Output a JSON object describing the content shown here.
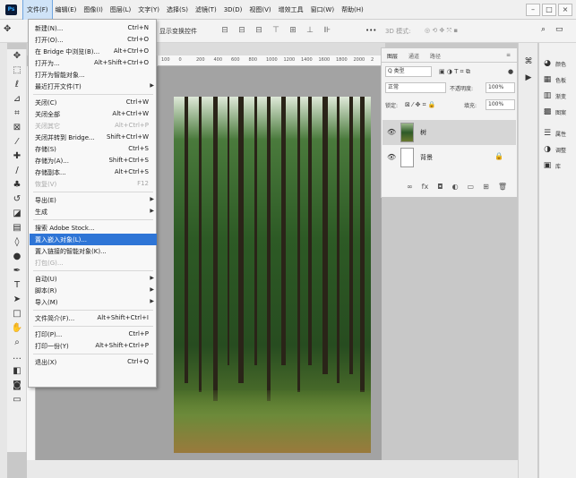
{
  "app": {
    "logo": "Ps"
  },
  "menubar": {
    "items": [
      "文件(F)",
      "编辑(E)",
      "图像(I)",
      "图层(L)",
      "文字(Y)",
      "选择(S)",
      "滤镜(T)",
      "3D(D)",
      "视图(V)",
      "增效工具",
      "窗口(W)",
      "帮助(H)"
    ],
    "window_buttons": [
      "–",
      "□",
      "×"
    ]
  },
  "options_bar": {
    "show_transform": "显示变换控件",
    "mode_3d": "3D 模式:",
    "more": "•••"
  },
  "ruler": {
    "top_ticks": [
      "100",
      "0",
      "200",
      "400",
      "600",
      "800",
      "1000",
      "1200",
      "1400",
      "1600",
      "1800",
      "2000",
      "2"
    ]
  },
  "file_menu": [
    {
      "label": "新建(N)...",
      "shortcut": "Ctrl+N",
      "disabled": false
    },
    {
      "label": "打开(O)...",
      "shortcut": "Ctrl+O",
      "disabled": false
    },
    {
      "label": "在 Bridge 中浏览(B)...",
      "shortcut": "Alt+Ctrl+O",
      "disabled": false
    },
    {
      "label": "打开为...",
      "shortcut": "Alt+Shift+Ctrl+O",
      "disabled": false
    },
    {
      "label": "打开为智能对象...",
      "shortcut": "",
      "disabled": false
    },
    {
      "label": "最近打开文件(T)",
      "shortcut": "",
      "disabled": false,
      "submenu": true
    },
    {
      "separator": true
    },
    {
      "label": "关闭(C)",
      "shortcut": "Ctrl+W",
      "disabled": false
    },
    {
      "label": "关闭全部",
      "shortcut": "Alt+Ctrl+W",
      "disabled": false
    },
    {
      "label": "关闭其它",
      "shortcut": "Alt+Ctrl+P",
      "disabled": true
    },
    {
      "label": "关闭并转到 Bridge...",
      "shortcut": "Shift+Ctrl+W",
      "disabled": false
    },
    {
      "label": "存储(S)",
      "shortcut": "Ctrl+S",
      "disabled": false
    },
    {
      "label": "存储为(A)...",
      "shortcut": "Shift+Ctrl+S",
      "disabled": false
    },
    {
      "label": "存储副本...",
      "shortcut": "Alt+Ctrl+S",
      "disabled": false
    },
    {
      "label": "恢复(V)",
      "shortcut": "F12",
      "disabled": true
    },
    {
      "separator": true
    },
    {
      "label": "导出(E)",
      "shortcut": "",
      "disabled": false,
      "submenu": true
    },
    {
      "label": "生成",
      "shortcut": "",
      "disabled": false,
      "submenu": true
    },
    {
      "separator": true
    },
    {
      "label": "搜索 Adobe Stock...",
      "shortcut": "",
      "disabled": false
    },
    {
      "label": "置入嵌入对象(L)...",
      "shortcut": "",
      "disabled": false,
      "highlight": true
    },
    {
      "label": "置入链接的智能对象(K)...",
      "shortcut": "",
      "disabled": false
    },
    {
      "label": "打包(G)...",
      "shortcut": "",
      "disabled": true
    },
    {
      "separator": true
    },
    {
      "label": "自动(U)",
      "shortcut": "",
      "disabled": false,
      "submenu": true
    },
    {
      "label": "脚本(R)",
      "shortcut": "",
      "disabled": false,
      "submenu": true
    },
    {
      "label": "导入(M)",
      "shortcut": "",
      "disabled": false,
      "submenu": true
    },
    {
      "separator": true
    },
    {
      "label": "文件简介(F)...",
      "shortcut": "Alt+Shift+Ctrl+I",
      "disabled": false
    },
    {
      "separator": true
    },
    {
      "label": "打印(P)...",
      "shortcut": "Ctrl+P",
      "disabled": false
    },
    {
      "label": "打印一份(Y)",
      "shortcut": "Alt+Shift+Ctrl+P",
      "disabled": false
    },
    {
      "separator": true
    },
    {
      "label": "退出(X)",
      "shortcut": "Ctrl+Q",
      "disabled": false
    }
  ],
  "layers_panel": {
    "tabs": [
      "图层",
      "通道",
      "路径"
    ],
    "kind_filter": "Q 类型",
    "blend_mode": "正常",
    "opacity_label": "不透明度:",
    "opacity_value": "100%",
    "lock_label": "锁定:",
    "fill_label": "填充:",
    "fill_value": "100%",
    "layers": [
      {
        "name": "树",
        "selected": true,
        "thumb": "forest"
      },
      {
        "name": "背景",
        "selected": false,
        "thumb": "white",
        "locked": true
      }
    ],
    "footer_icons": [
      "link-icon",
      "fx-icon",
      "mask-icon",
      "adjustment-icon",
      "group-icon",
      "new-layer-icon",
      "trash-icon"
    ]
  },
  "right_panel": {
    "items": [
      "颜色",
      "色板",
      "渐变",
      "图案",
      "属性",
      "调整",
      "库"
    ]
  }
}
